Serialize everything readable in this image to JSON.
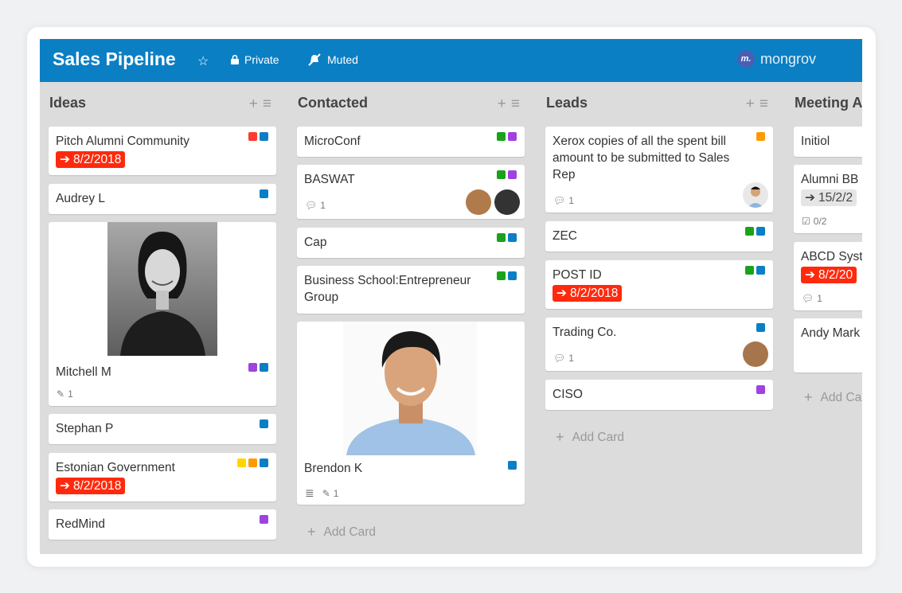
{
  "board": {
    "title": "Sales Pipeline",
    "privacy": "Private",
    "notifications": "Muted",
    "brand": "mongrov",
    "brand_logo_text": "m."
  },
  "add_card_label": "Add Card",
  "colors": {
    "header": "#0b7fc4",
    "red": "#ff3b30",
    "blue": "#0b7fc4",
    "green": "#1aa31a",
    "purple": "#a142e0",
    "orange": "#ff9a00",
    "yellow": "#ffd400",
    "due": "#ff2a0d"
  },
  "columns": [
    {
      "title": "Ideas",
      "cards": [
        {
          "title": "Pitch Alumni Community",
          "due": "8/2/2018",
          "labels": [
            "red",
            "blue"
          ]
        },
        {
          "title": "Audrey L",
          "labels": [
            "blue"
          ]
        },
        {
          "title": "Mitchell M",
          "labels": [
            "purple",
            "blue"
          ],
          "attachments": "1"
        },
        {
          "title": "Stephan P",
          "labels": [
            "blue"
          ]
        },
        {
          "title": "Estonian Government",
          "due": "8/2/2018",
          "labels": [
            "yellow",
            "orange",
            "blue"
          ]
        },
        {
          "title": "RedMind",
          "labels": [
            "purple"
          ]
        }
      ]
    },
    {
      "title": "Contacted",
      "cards": [
        {
          "title": "MicroConf",
          "labels": [
            "green",
            "purple"
          ]
        },
        {
          "title": "BASWAT",
          "labels": [
            "green",
            "purple"
          ],
          "comments": "1"
        },
        {
          "title": "Cap",
          "labels": [
            "green",
            "blue"
          ]
        },
        {
          "title": "Business School:Entrepreneur Group",
          "labels": [
            "green",
            "blue"
          ]
        },
        {
          "title": "Brendon K",
          "labels": [
            "blue"
          ],
          "attachments": "1"
        }
      ]
    },
    {
      "title": "Leads",
      "cards": [
        {
          "title": "Xerox copies of all the spent bill amount to be submitted to Sales Rep",
          "labels": [
            "orange"
          ],
          "comments": "1"
        },
        {
          "title": "ZEC",
          "labels": [
            "green",
            "blue"
          ]
        },
        {
          "title": "POST ID",
          "due": "8/2/2018",
          "labels": [
            "green",
            "blue"
          ]
        },
        {
          "title": "Trading Co.",
          "labels": [
            "blue"
          ],
          "comments": "1"
        },
        {
          "title": "CISO",
          "labels": [
            "purple"
          ]
        }
      ]
    },
    {
      "title": "Meeting A",
      "cards": [
        {
          "title": "Initiol"
        },
        {
          "title": "Alumni BB",
          "due": "15/2/2",
          "checklist": "0/2"
        },
        {
          "title": "ABCD Syst",
          "due": "8/2/20",
          "comments": "1"
        },
        {
          "title": "Andy Mark"
        }
      ]
    }
  ]
}
